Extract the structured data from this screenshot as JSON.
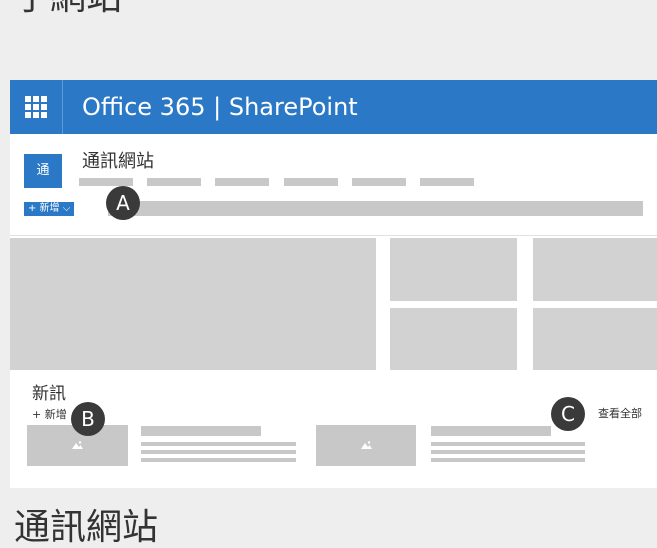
{
  "captions": {
    "top": "子網站",
    "bottom": "通訊網站"
  },
  "suite_bar": {
    "brand": "Office 365  |  SharePoint",
    "waffle_icon": "app-launcher-icon"
  },
  "site": {
    "logo_letter": "通",
    "title": "通訊網站",
    "new_button": "+ 新增 ⌵"
  },
  "news": {
    "title": "新訊",
    "add_label": "+ 新增",
    "view_all": "查看全部"
  },
  "callouts": [
    "A",
    "B",
    "C"
  ],
  "colors": {
    "accent": "#2a78c6",
    "placeholder": "#c8c8c8",
    "callout": "#3a3a3a"
  }
}
